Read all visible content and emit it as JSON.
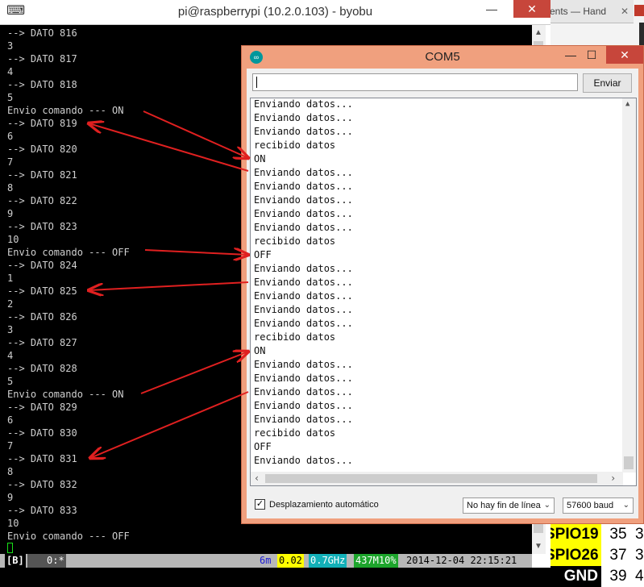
{
  "background": {
    "tab_label": "ents — Hand",
    "tab_close": "✕"
  },
  "gpio_table": [
    {
      "name": "SPIO19",
      "pin": "35",
      "extra": "3",
      "color": "#ffff00"
    },
    {
      "name": "SPIO26",
      "pin": "37",
      "extra": "3",
      "color": "#ffff00"
    },
    {
      "name": "GND",
      "pin": "39",
      "extra": "4",
      "color": "#000000"
    }
  ],
  "putty": {
    "title": "pi@raspberrypi (10.2.0.103) - byobu",
    "controls": {
      "minimize": "—",
      "close": "✕"
    },
    "lines": [
      "--> DATO 816",
      "3",
      "--> DATO 817",
      "4",
      "--> DATO 818",
      "5",
      "Envio comando --- ON",
      "--> DATO 819",
      "6",
      "--> DATO 820",
      "7",
      "--> DATO 821",
      "8",
      "--> DATO 822",
      "9",
      "--> DATO 823",
      "10",
      "Envio comando --- OFF",
      "--> DATO 824",
      "1",
      "--> DATO 825",
      "2",
      "--> DATO 826",
      "3",
      "--> DATO 827",
      "4",
      "--> DATO 828",
      "5",
      "Envio comando --- ON",
      "--> DATO 829",
      "6",
      "--> DATO 830",
      "7",
      "--> DATO 831",
      "8",
      "--> DATO 832",
      "9",
      "--> DATO 833",
      "10",
      "Envio comando --- OFF"
    ],
    "statusbar": {
      "session": "[B]",
      "window": "0:*",
      "uptime": "6m",
      "load": "0.02",
      "cpu": "0.7GHz",
      "mem": "437M10%",
      "datetime": "2014-12-04 22:15:21"
    }
  },
  "com5": {
    "title": "COM5",
    "controls": {
      "minimize": "—",
      "maximize": "☐",
      "close": "✕"
    },
    "input_value": "",
    "send_label": "Enviar",
    "lines": [
      "Enviando datos...",
      "Enviando datos...",
      "Enviando datos...",
      "recibido datos",
      "ON",
      "Enviando datos...",
      "Enviando datos...",
      "Enviando datos...",
      "Enviando datos...",
      "Enviando datos...",
      "recibido datos",
      "OFF",
      "Enviando datos...",
      "Enviando datos...",
      "Enviando datos...",
      "Enviando datos...",
      "Enviando datos...",
      "recibido datos",
      "ON",
      "Enviando datos...",
      "Enviando datos...",
      "Enviando datos...",
      "Enviando datos...",
      "Enviando datos...",
      "recibido datos",
      "OFF",
      "Enviando datos..."
    ],
    "autoscroll_checked": true,
    "autoscroll_label": "Desplazamiento automático",
    "line_ending": "No hay fin de línea",
    "baud": "57600 baud"
  },
  "colors": {
    "arrow": "#e02020",
    "com5_frame": "#f0a07e",
    "close_button": "#c7463b"
  }
}
